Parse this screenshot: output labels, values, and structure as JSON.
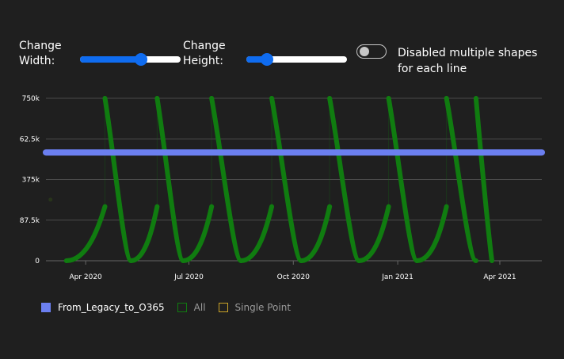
{
  "controls": {
    "width_label_line1": "Change",
    "width_label_line2": "Width:",
    "width_slider_value": 0.62,
    "height_label_line1": "Change",
    "height_label_line2": "Height:",
    "height_slider_value": 0.16,
    "toggle_on": false,
    "toggle_label": "Disabled multiple shapes for each line",
    "accent_color": "#0f6cf0"
  },
  "chart_data": {
    "type": "line",
    "y_ticks": [
      "0",
      "87.5k",
      "375k",
      "62.5k",
      "750k"
    ],
    "y_tick_values": [
      0,
      187500,
      375000,
      562500,
      750000
    ],
    "ylim": [
      0,
      750000
    ],
    "x_ticks": [
      "Apr 2020",
      "Jul 2020",
      "Oct 2020",
      "Jan 2021",
      "Apr 2021"
    ],
    "x_tick_dates": [
      "2020-04-01",
      "2020-07-01",
      "2020-10-01",
      "2021-01-01",
      "2021-04-01"
    ],
    "xlim": [
      "2020-02-26",
      "2021-05-08"
    ],
    "grid": true,
    "legend_position": "bottom-left",
    "series": [
      {
        "name": "From_Legacy_to_O365",
        "color": "#6b7ff0",
        "style": "horizontal line",
        "points": [
          [
            "2020-02-26",
            500000
          ],
          [
            "2021-05-08",
            500000
          ]
        ]
      },
      {
        "name": "All",
        "color": "#107c10",
        "style": "repeating cycles",
        "cycles": [
          {
            "start": "2020-03-15",
            "peak": "2020-04-18",
            "end": "2020-05-11",
            "start_value": 0,
            "peak_low": 250000,
            "peak_high": 750000,
            "end_value": 0
          },
          {
            "start": "2020-05-11",
            "peak": "2020-06-03",
            "end": "2020-06-26",
            "start_value": 0,
            "peak_low": 250000,
            "peak_high": 750000,
            "end_value": 0
          },
          {
            "start": "2020-06-26",
            "peak": "2020-07-21",
            "end": "2020-08-16",
            "start_value": 0,
            "peak_low": 250000,
            "peak_high": 750000,
            "end_value": 0
          },
          {
            "start": "2020-08-16",
            "peak": "2020-09-12",
            "end": "2020-10-08",
            "start_value": 0,
            "peak_low": 250000,
            "peak_high": 750000,
            "end_value": 0
          },
          {
            "start": "2020-10-08",
            "peak": "2020-11-02",
            "end": "2020-11-28",
            "start_value": 0,
            "peak_low": 250000,
            "peak_high": 750000,
            "end_value": 0
          },
          {
            "start": "2020-11-28",
            "peak": "2020-12-24",
            "end": "2021-01-18",
            "start_value": 0,
            "peak_low": 250000,
            "peak_high": 750000,
            "end_value": 0
          },
          {
            "start": "2021-01-18",
            "peak": "2021-02-13",
            "end": "2021-03-11",
            "start_value": 0,
            "peak_low": 250000,
            "peak_high": 750000,
            "end_value": 0
          }
        ],
        "last_peak": "2021-03-11",
        "last_end": "2021-03-25"
      },
      {
        "name": "Single Point",
        "color": "#c9a227",
        "style": "single point",
        "points": [
          [
            "2020-03-01",
            282000
          ]
        ]
      }
    ]
  },
  "legend": {
    "items": [
      {
        "label": "From_Legacy_to_O365",
        "color": "#6b7ff0",
        "filled": true
      },
      {
        "label": "All",
        "color": "#107c10",
        "filled": false
      },
      {
        "label": "Single Point",
        "color": "#c9a227",
        "filled": false
      }
    ]
  }
}
